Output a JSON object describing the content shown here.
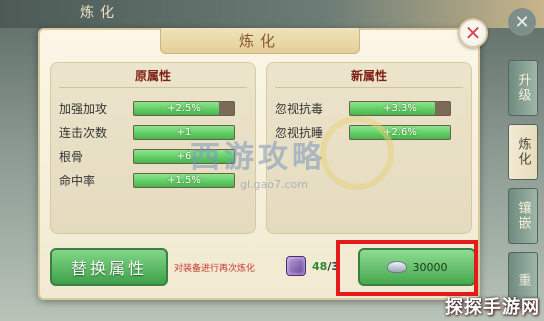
{
  "background": {
    "tab_title": "炼化",
    "side_tabs": [
      "升级",
      "炼化",
      "镶嵌",
      "重"
    ]
  },
  "dialog": {
    "title": "炼化",
    "close_label": "✕"
  },
  "original_panel": {
    "heading": "原属性",
    "rows": [
      {
        "label": "加强加攻",
        "value": "+2.5%",
        "fill": 0.85
      },
      {
        "label": "连击次数",
        "value": "+1",
        "fill": 1.0
      },
      {
        "label": "根骨",
        "value": "+6",
        "fill": 1.0
      },
      {
        "label": "命中率",
        "value": "+1.5%",
        "fill": 1.0
      }
    ]
  },
  "new_panel": {
    "heading": "新属性",
    "rows": [
      {
        "label": "忽视抗毒",
        "value": "+3.3%",
        "fill": 0.85
      },
      {
        "label": "忽视抗睡",
        "value": "+2.6%",
        "fill": 1.0
      }
    ]
  },
  "bottom": {
    "replace_button": "替换属性",
    "hint": "对装备进行再次炼化",
    "item_count_current": "48",
    "item_count_sep": "/3",
    "cost_button_value": "30000"
  },
  "watermark": {
    "main": "西游攻略",
    "sub": "gl.gao7.com"
  },
  "brand": "探探手游网",
  "colors": {
    "highlight": "#e51b1b",
    "bar_fill": "#43b84a",
    "button_green": "#46a84e",
    "panel_heading": "#7c1f13",
    "hint_red": "#c83a30"
  }
}
